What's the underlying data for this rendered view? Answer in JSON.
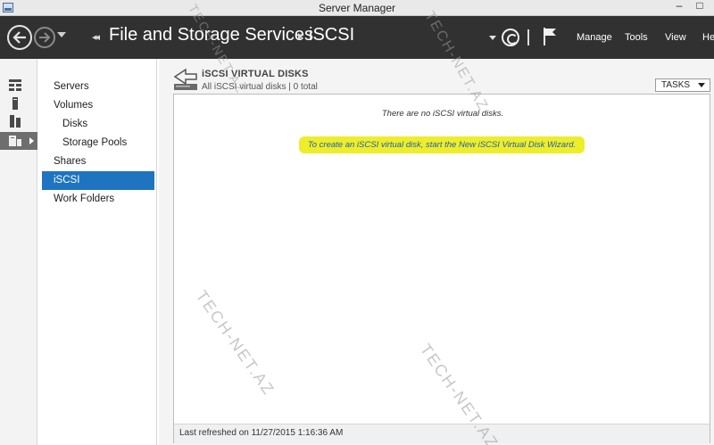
{
  "window": {
    "title": "Server Manager",
    "minimize_glyph": "–",
    "maximize_glyph": "□"
  },
  "header": {
    "breadcrumb_arrows": "◂◂",
    "breadcrumb_parent": "File and Storage Services",
    "breadcrumb_current": "iSCSI",
    "menu": [
      "Manage",
      "Tools",
      "View",
      "Help"
    ]
  },
  "rail": {
    "items": [
      {
        "icon": "dashboard-icon"
      },
      {
        "icon": "local-server-icon"
      },
      {
        "icon": "all-servers-icon"
      },
      {
        "icon": "file-storage-icon",
        "active": true
      }
    ]
  },
  "subnav": {
    "items": [
      {
        "label": "Servers",
        "level": 0
      },
      {
        "label": "Volumes",
        "level": 0
      },
      {
        "label": "Disks",
        "level": 1
      },
      {
        "label": "Storage Pools",
        "level": 1
      },
      {
        "label": "Shares",
        "level": 0
      },
      {
        "label": "iSCSI",
        "level": 0,
        "selected": true
      },
      {
        "label": "Work Folders",
        "level": 0
      }
    ]
  },
  "main": {
    "group_title": "iSCSI VIRTUAL DISKS",
    "group_subtitle": "All iSCSI virtual disks | 0 total",
    "tasks_label": "TASKS",
    "empty_message": "There are no iSCSI virtual disks.",
    "wizard_link": "To create an iSCSI virtual disk, start the New iSCSI Virtual Disk Wizard.",
    "highlight_color": "#eded2a",
    "status": "Last refreshed on 11/27/2015 1:16:36 AM"
  },
  "watermark": "TECH-NET.AZ",
  "colors": {
    "header_bg": "#313131",
    "selection_blue": "#1e74c0",
    "link_blue": "#1f5fb5"
  }
}
